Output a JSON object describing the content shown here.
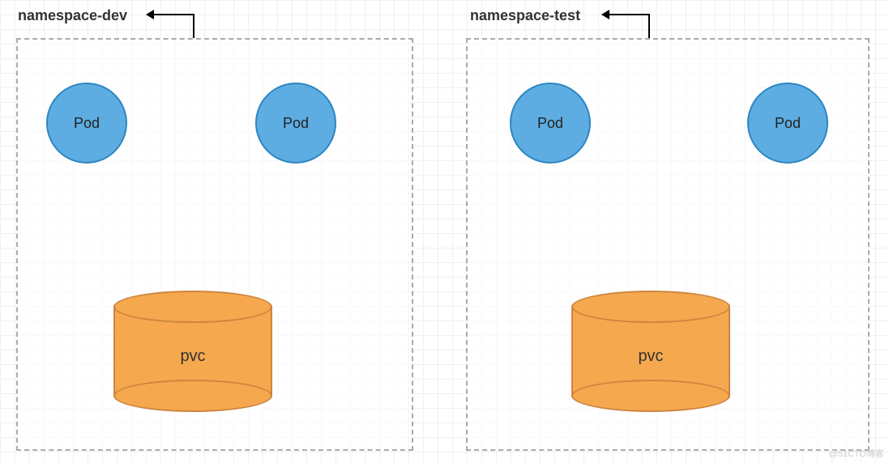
{
  "namespaces": [
    {
      "label": "namespace-dev",
      "pods": [
        "Pod",
        "Pod"
      ],
      "pvc": "pvc"
    },
    {
      "label": "namespace-test",
      "pods": [
        "Pod",
        "Pod"
      ],
      "pvc": "pvc"
    }
  ],
  "watermark": "@51CTO博客"
}
